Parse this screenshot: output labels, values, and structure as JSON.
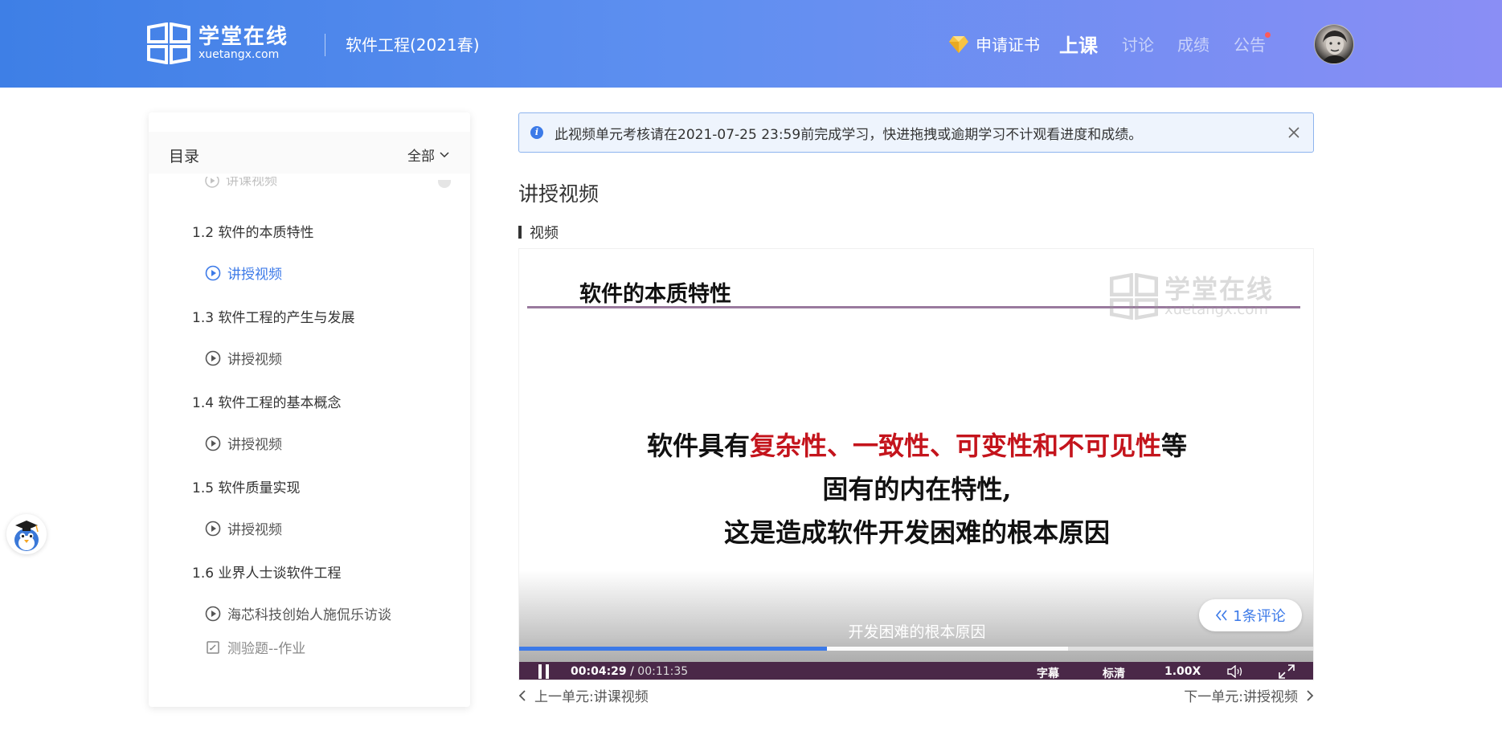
{
  "header": {
    "logo_cn": "学堂在线",
    "logo_en": "xuetangx.com",
    "course_title": "软件工程(2021春)",
    "cert_label": "申请证书",
    "nav": [
      {
        "label": "上课",
        "active": true
      },
      {
        "label": "讨论",
        "active": false
      },
      {
        "label": "成绩",
        "active": false
      },
      {
        "label": "公告",
        "active": false
      }
    ]
  },
  "sidebar": {
    "title": "目录",
    "filter_label": "全部",
    "partial_item": "讲课视频",
    "sections": [
      {
        "label": "1.2 软件的本质特性",
        "item": "讲授视频",
        "item_state": "active"
      },
      {
        "label": "1.3 软件工程的产生与发展",
        "item": "讲授视频",
        "item_state": "normal"
      },
      {
        "label": "1.4 软件工程的基本概念",
        "item": "讲授视频",
        "item_state": "normal"
      },
      {
        "label": "1.5 软件质量实现",
        "item": "讲授视频",
        "item_state": "normal"
      },
      {
        "label": "1.6 业界人士谈软件工程",
        "item": "海芯科技创始人施侃乐访谈",
        "item_state": "normal",
        "extra_item": "测验题--作业"
      }
    ]
  },
  "notice": {
    "text": "此视频单元考核请在2021-07-25 23:59前完成学习，快进拖拽或逾期学习不计观看进度和成绩。"
  },
  "main": {
    "unit_title": "讲授视频",
    "video_label": "视频"
  },
  "video": {
    "slide_title": "软件的本质特性",
    "watermark_cn": "学堂在线",
    "watermark_en": "xuetangx.com",
    "body_line1_a": "软件具有",
    "body_line1_b": "复杂性、一致性、可变性和不可见性",
    "body_line1_c": "等",
    "body_line2": "固有的内在特性,",
    "body_line3": "这是造成软件开发困难的根本原因",
    "subtitle": "开发困难的根本原因",
    "comment_label": "1条评论",
    "current_time": "00:04:29",
    "time_separator": " / ",
    "total_time": "00:11:35",
    "progress_fraction": 0.387,
    "buffer_fraction": 0.69,
    "caption_label": "字幕",
    "quality_label": "标清",
    "speed_label": "1.00X"
  },
  "unit_nav": {
    "prev_label": "上一单元:",
    "prev_name": "讲课视频",
    "next_label": "下一单元:",
    "next_name": "讲授视频"
  },
  "colors": {
    "accent": "#3c7ae8",
    "header_start": "#3e7fe6",
    "header_end": "#8a8ef5",
    "slide_red": "#c4141c",
    "controls_bg": "#4a2848"
  }
}
